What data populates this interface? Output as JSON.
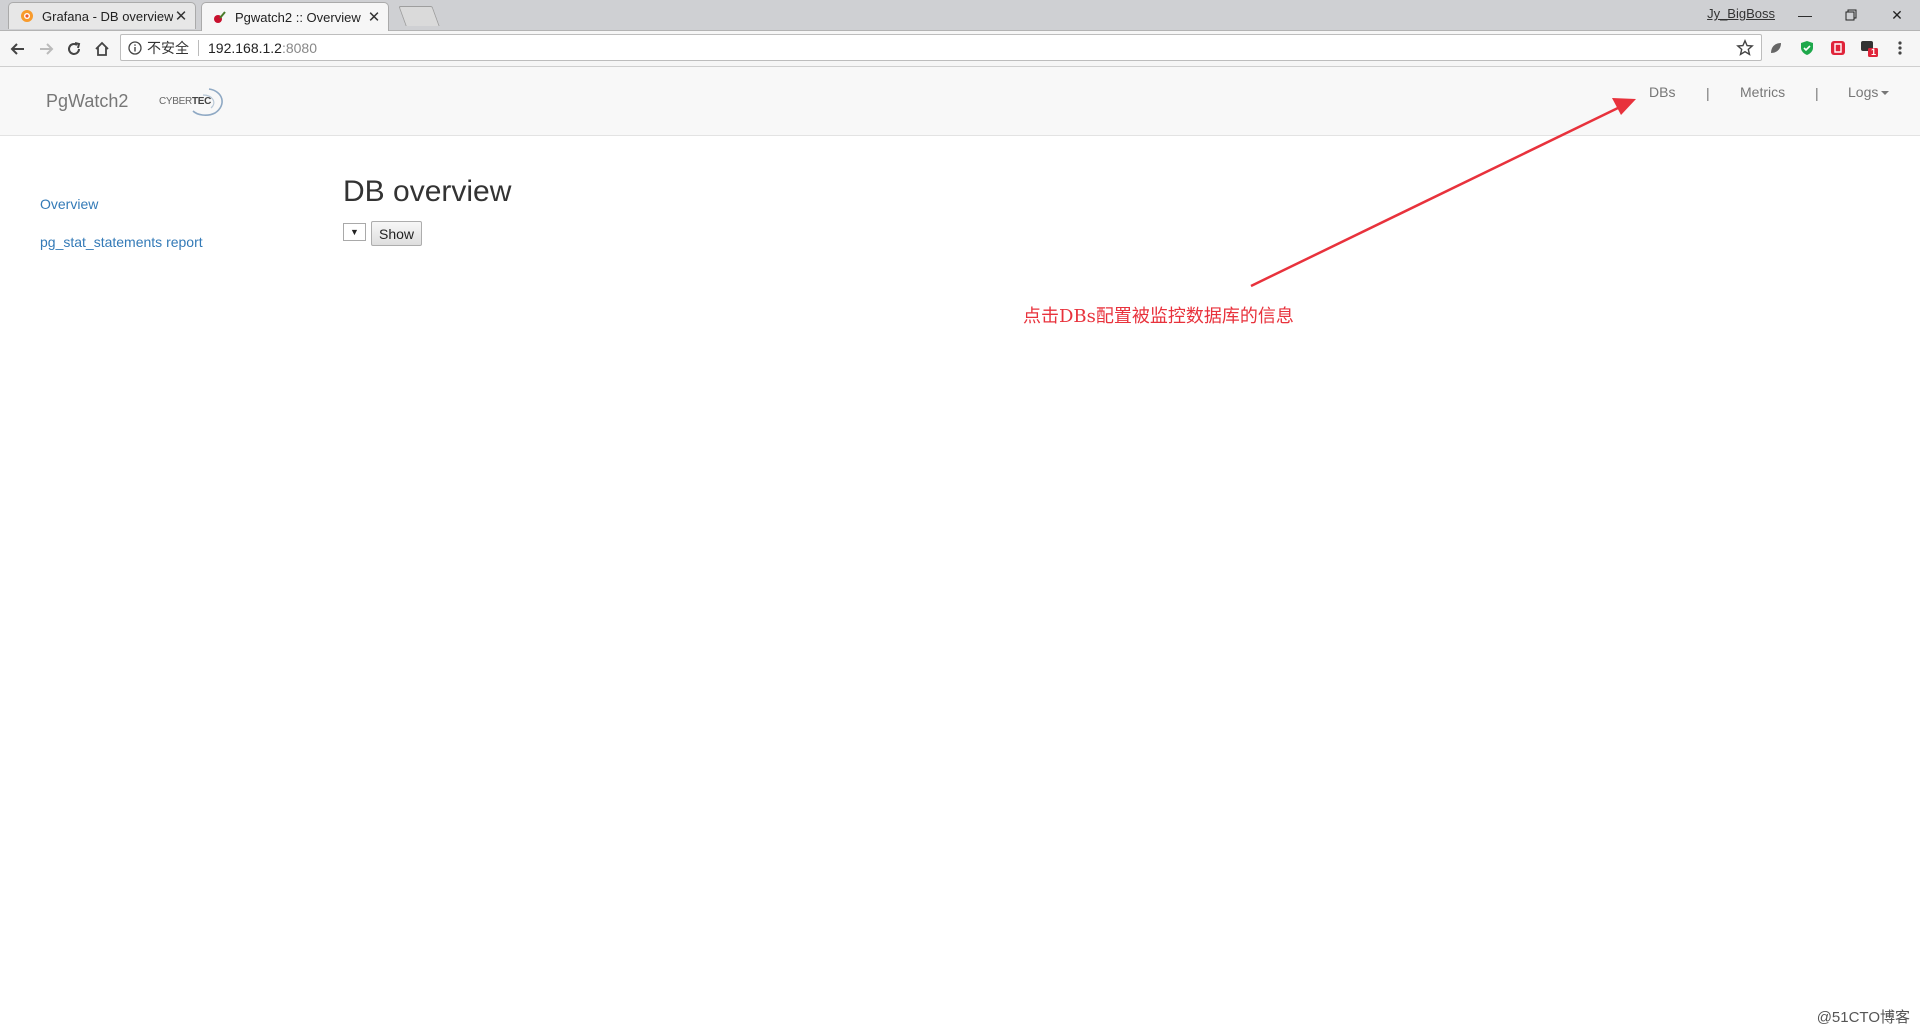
{
  "browser": {
    "tabs": [
      {
        "title": "Grafana - DB overview",
        "active": false,
        "icon": "grafana-icon"
      },
      {
        "title": "Pgwatch2 :: Overview",
        "active": true,
        "icon": "pgwatch-icon"
      }
    ],
    "profile_name": "Jy_BigBoss",
    "address": {
      "security_label": "不安全",
      "host": "192.168.1.2",
      "port": ":8080"
    },
    "extension_badge": "1"
  },
  "navbar": {
    "brand": "PgWatch2",
    "logo_text_light": "CYBER",
    "logo_text_bold": "TEC",
    "links": [
      {
        "label": "DBs"
      },
      {
        "label": "Metrics"
      },
      {
        "label": "Logs"
      }
    ],
    "separator": "|"
  },
  "sidebar": {
    "items": [
      {
        "label": "Overview"
      },
      {
        "label": "pg_stat_statements report"
      }
    ]
  },
  "main": {
    "title": "DB overview",
    "select_glyph": "▼",
    "show_button": "Show"
  },
  "annotation": {
    "text": "点击DBs配置被监控数据库的信息",
    "color": "#e8323c"
  },
  "watermark": "@51CTO博客"
}
